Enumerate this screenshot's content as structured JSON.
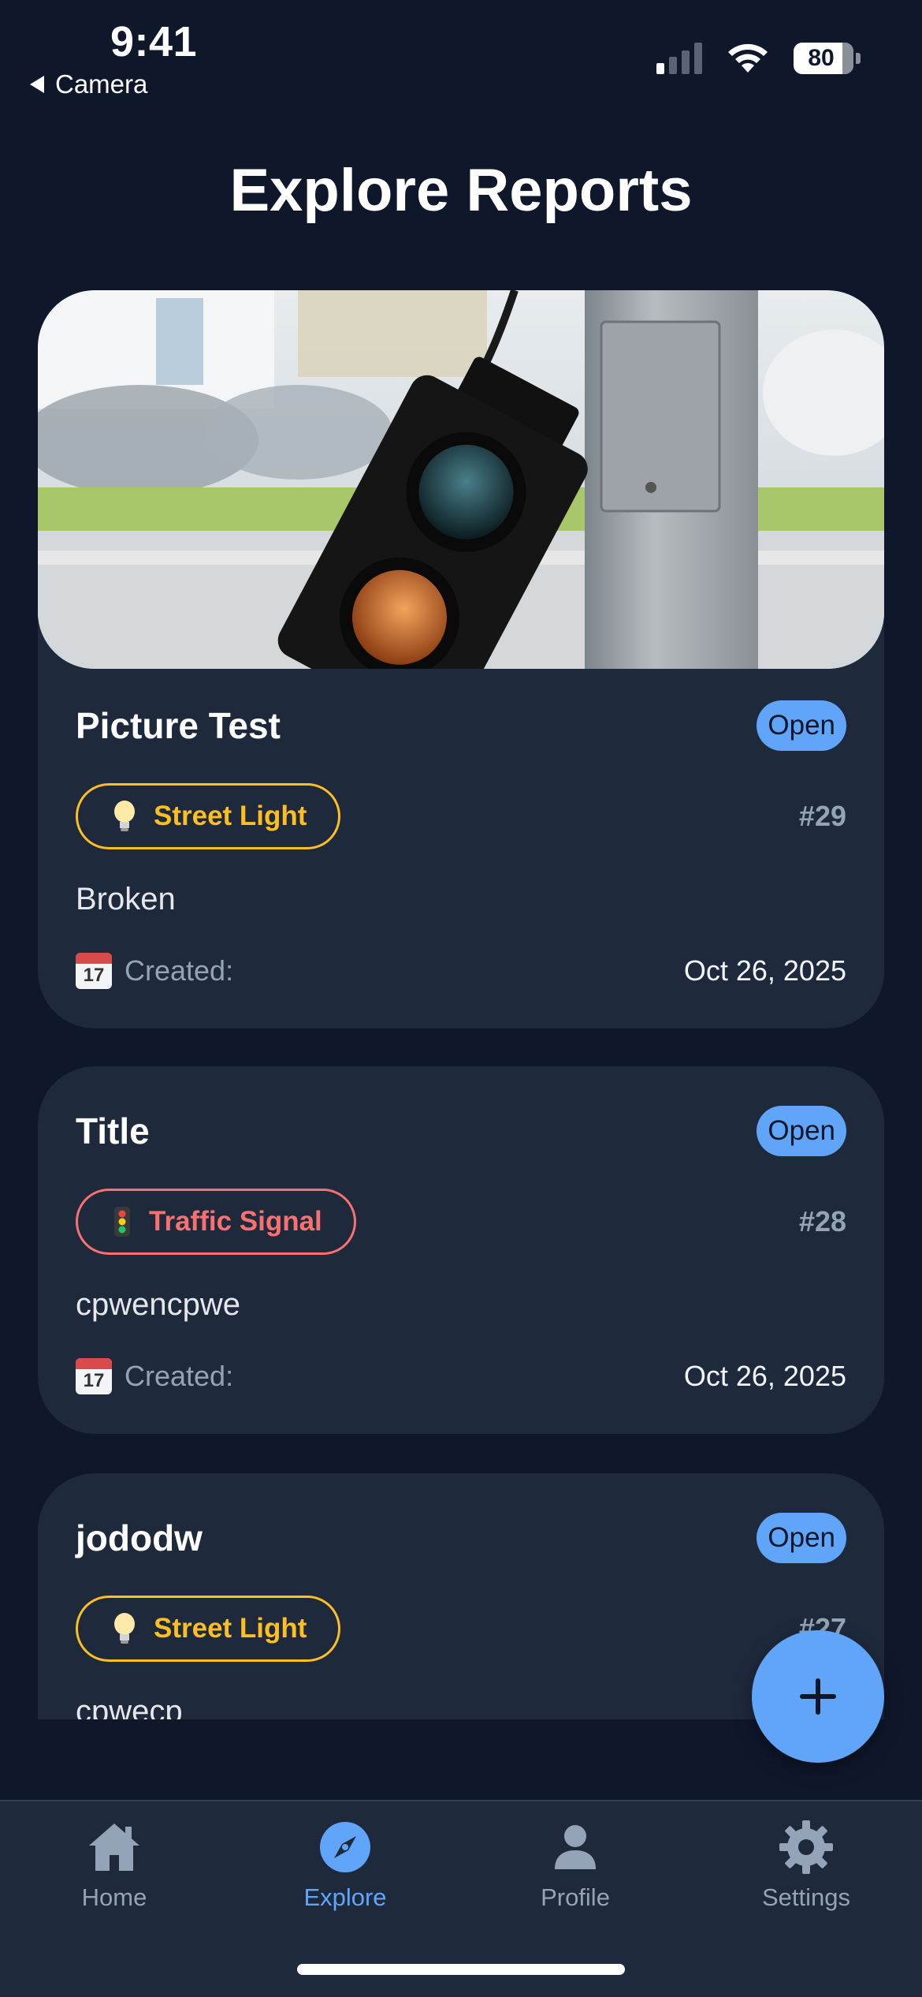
{
  "status_bar": {
    "time": "9:41",
    "back_label": "Camera",
    "battery": "80"
  },
  "page": {
    "title": "Explore Reports"
  },
  "reports": [
    {
      "title": "Picture Test",
      "status": "Open",
      "category": "Street Light",
      "category_icon": "lightbulb-icon",
      "id": "#29",
      "description": "Broken",
      "created_label": "Created:",
      "created_date": "Oct 26, 2025",
      "calendar_day": "17"
    },
    {
      "title": "Title",
      "status": "Open",
      "category": "Traffic Signal",
      "category_icon": "traffic-light-icon",
      "id": "#28",
      "description": "cpwencpwe",
      "created_label": "Created:",
      "created_date": "Oct 26, 2025",
      "calendar_day": "17"
    },
    {
      "title": "jododw",
      "status": "Open",
      "category": "Street Light",
      "category_icon": "lightbulb-icon",
      "id": "#27",
      "description": "cpwecp"
    }
  ],
  "tab_bar": {
    "items": [
      {
        "label": "Home",
        "icon": "home-icon",
        "active": false
      },
      {
        "label": "Explore",
        "icon": "compass-icon",
        "active": true
      },
      {
        "label": "Profile",
        "icon": "person-icon",
        "active": false
      },
      {
        "label": "Settings",
        "icon": "gear-icon",
        "active": false
      }
    ]
  },
  "colors": {
    "background": "#0f172a",
    "card": "#1e293b",
    "accent": "#60a5fa",
    "street_light": "#fbbf24",
    "traffic_signal": "#f87171"
  }
}
